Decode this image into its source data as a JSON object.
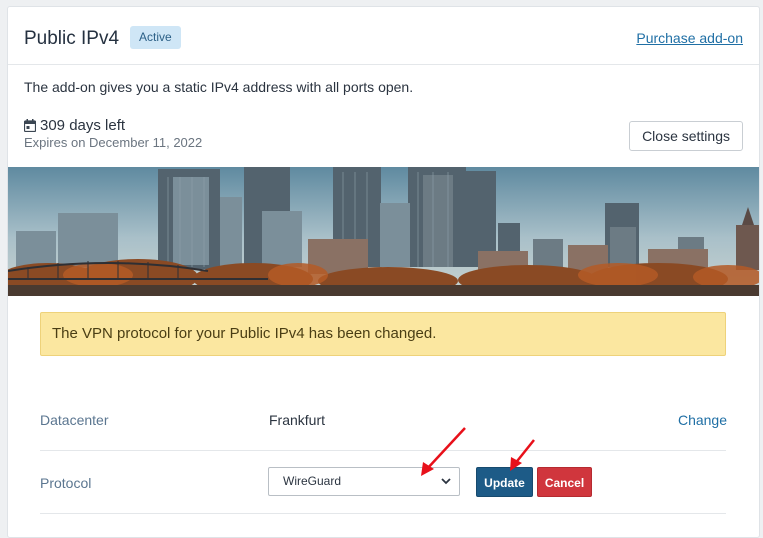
{
  "header": {
    "title": "Public IPv4",
    "status_badge": "Active",
    "purchase_link": "Purchase add-on"
  },
  "description": "The add-on gives you a static IPv4 address with all ports open.",
  "subscription": {
    "days_left": "309 days left",
    "expires": "Expires on December 11, 2022",
    "close_settings_label": "Close settings"
  },
  "banner": {
    "icon": "city-skyline-photo"
  },
  "alert": {
    "message": "The VPN protocol for your Public IPv4 has been changed.",
    "color": "#fbe7a0"
  },
  "settings": {
    "datacenter_label": "Datacenter",
    "datacenter_value": "Frankfurt",
    "change_label": "Change",
    "protocol_label": "Protocol",
    "protocol_selected": "WireGuard",
    "update_label": "Update",
    "cancel_label": "Cancel"
  },
  "colors": {
    "link": "#1f6fa5",
    "primary_button": "#1d5b87",
    "danger_button": "#d0363d",
    "annotation_arrow": "#e8101a"
  },
  "annotations": {
    "icon": "red-arrow-icon"
  }
}
